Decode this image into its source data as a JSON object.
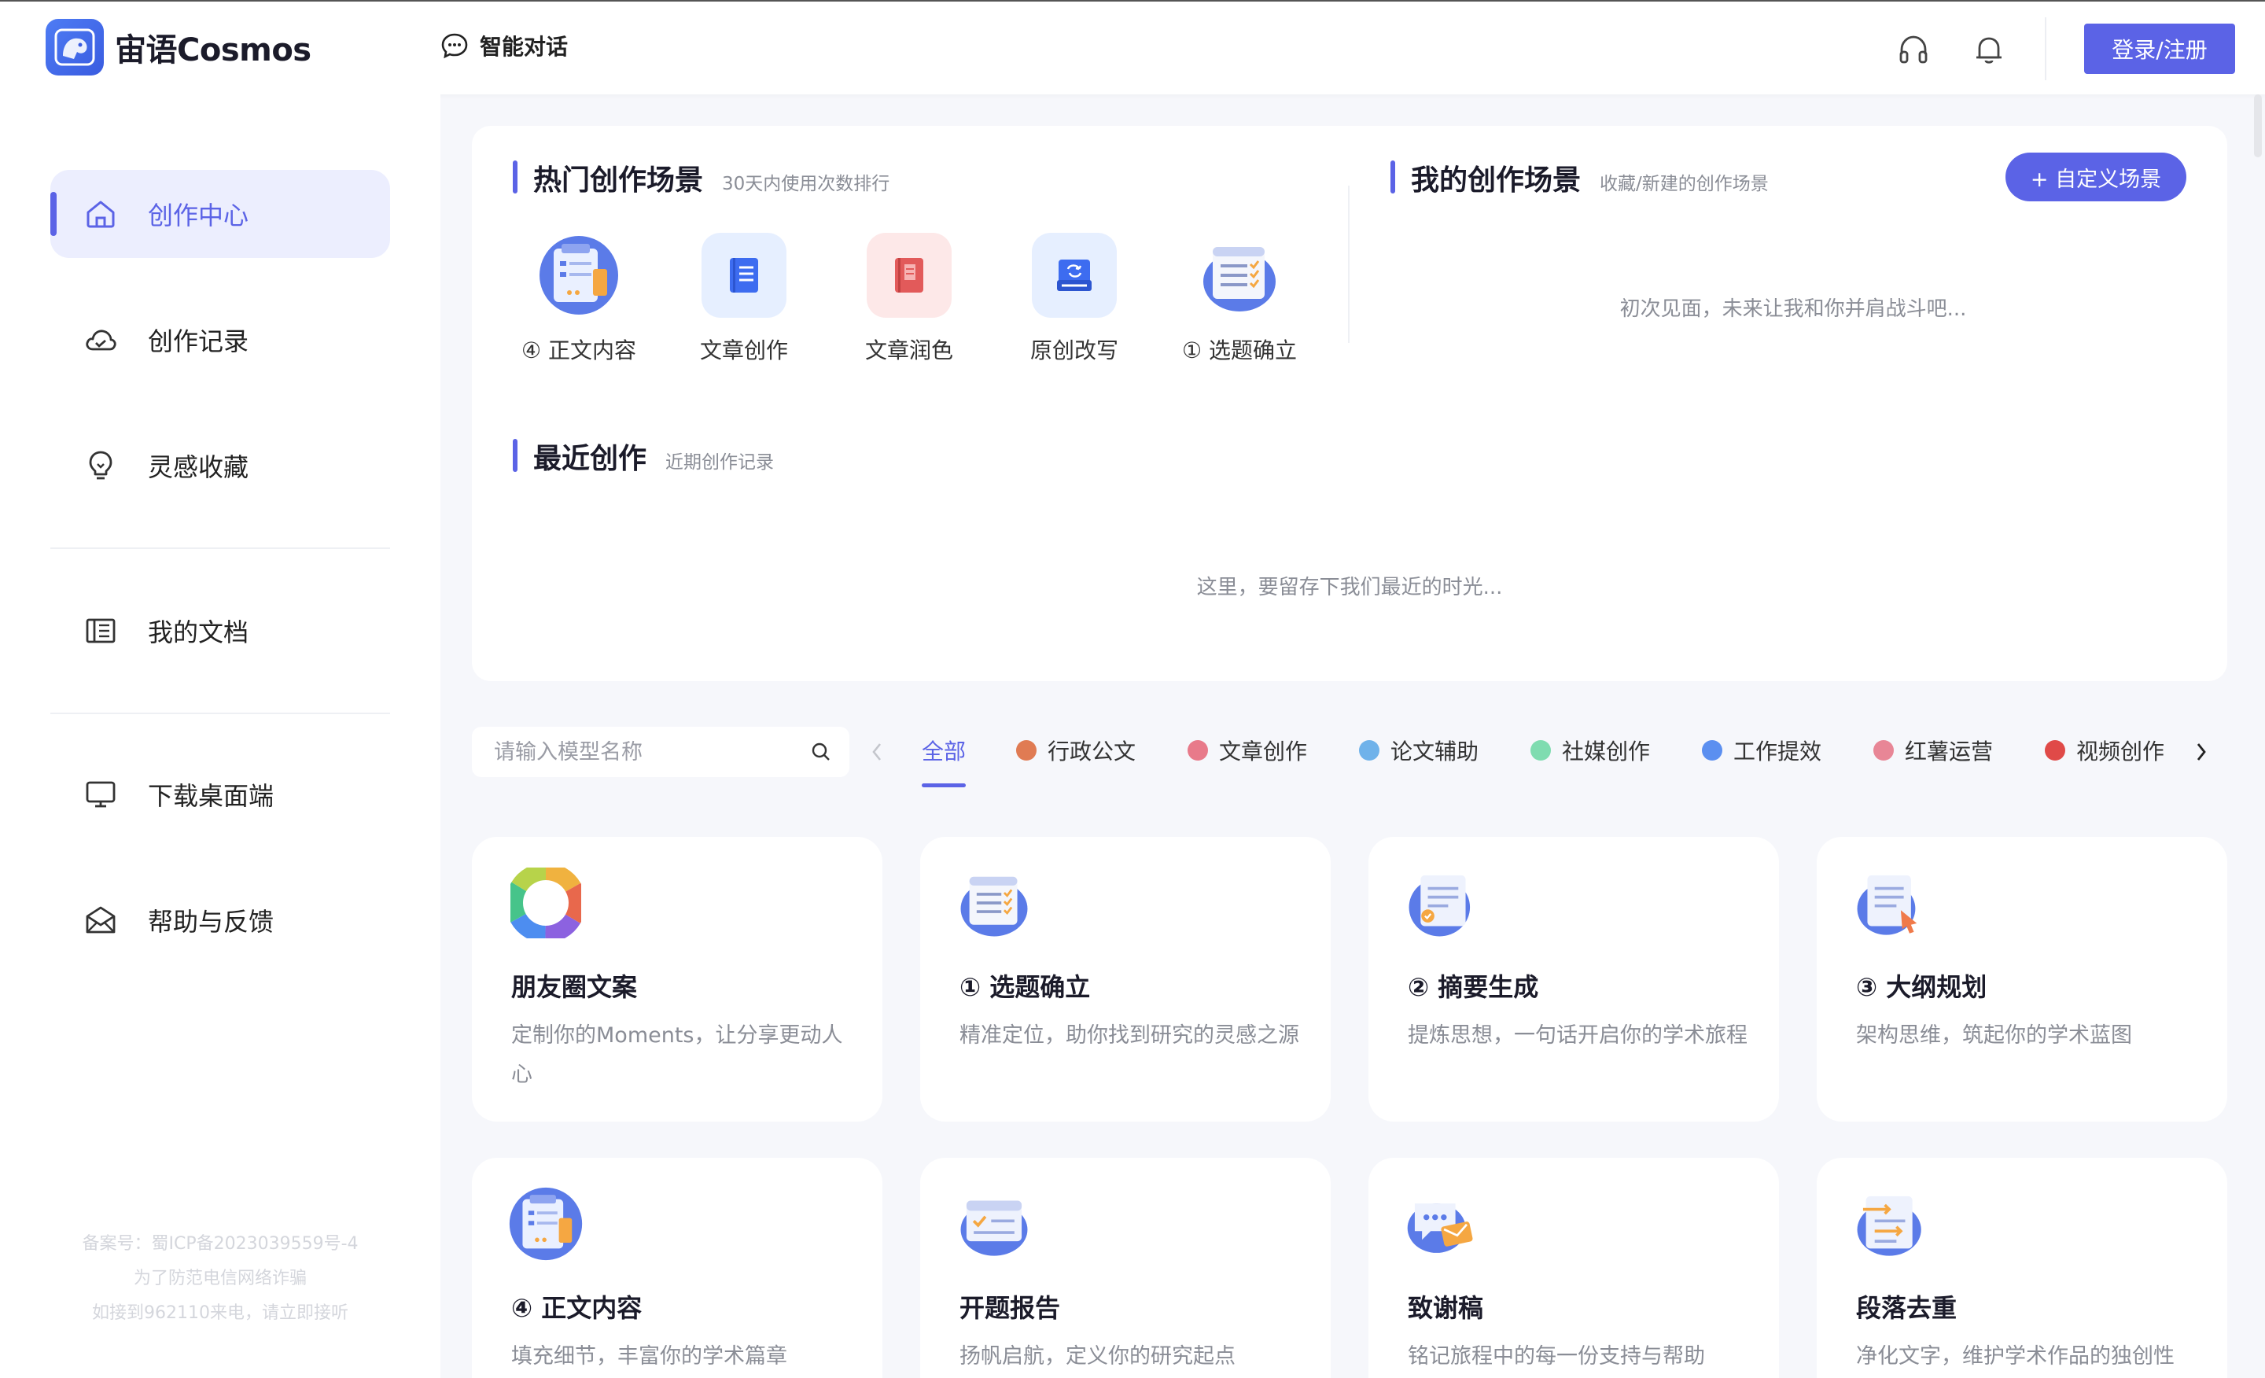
{
  "app": {
    "name": "宙语Cosmos"
  },
  "header": {
    "chat_label": "智能对话",
    "login_label": "登录/注册"
  },
  "sidebar": {
    "items": [
      {
        "label": "创作中心",
        "icon": "home-icon"
      },
      {
        "label": "创作记录",
        "icon": "cloud-icon"
      },
      {
        "label": "灵感收藏",
        "icon": "lightbulb-icon"
      },
      {
        "label": "我的文档",
        "icon": "document-book-icon"
      },
      {
        "label": "下载桌面端",
        "icon": "monitor-icon"
      },
      {
        "label": "帮助与反馈",
        "icon": "mail-icon"
      }
    ],
    "beian": [
      "备案号：蜀ICP备2023039559号-4",
      "为了防范电信网络诈骗",
      "如接到962110来电，请立即接听"
    ]
  },
  "hot": {
    "title": "热门创作场景",
    "subtitle": "30天内使用次数排行",
    "items": [
      {
        "label": "④ 正文内容"
      },
      {
        "label": "文章创作"
      },
      {
        "label": "文章润色"
      },
      {
        "label": "原创改写"
      },
      {
        "label": "① 选题确立"
      }
    ]
  },
  "mine": {
    "title": "我的创作场景",
    "subtitle": "收藏/新建的创作场景",
    "button": "+ 自定义场景",
    "empty": "初次见面，未来让我和你并肩战斗吧..."
  },
  "recent": {
    "title": "最近创作",
    "subtitle": "近期创作记录",
    "empty": "这里，要留存下我们最近的时光..."
  },
  "search": {
    "placeholder": "请输入模型名称"
  },
  "categories": [
    {
      "label": "全部",
      "color": ""
    },
    {
      "label": "行政公文",
      "color": "#e07b53"
    },
    {
      "label": "文章创作",
      "color": "#e87a8a"
    },
    {
      "label": "论文辅助",
      "color": "#6fb2ea"
    },
    {
      "label": "社媒创作",
      "color": "#7fdcb0"
    },
    {
      "label": "工作提效",
      "color": "#5b8ff0"
    },
    {
      "label": "红薯运营",
      "color": "#e88696"
    },
    {
      "label": "视频创作",
      "color": "#e04a48"
    }
  ],
  "cards": [
    {
      "title": "朋友圈文案",
      "desc": "定制你的Moments，让分享更动人心"
    },
    {
      "title": "① 选题确立",
      "desc": "精准定位，助你找到研究的灵感之源"
    },
    {
      "title": "② 摘要生成",
      "desc": "提炼思想，一句话开启你的学术旅程"
    },
    {
      "title": "③ 大纲规划",
      "desc": "架构思维，筑起你的学术蓝图"
    },
    {
      "title": "④ 正文内容",
      "desc": "填充细节，丰富你的学术篇章"
    },
    {
      "title": "开题报告",
      "desc": "扬帆启航，定义你的研究起点"
    },
    {
      "title": "致谢稿",
      "desc": "铭记旅程中的每一份支持与帮助"
    },
    {
      "title": "段落去重",
      "desc": "净化文字，维护学术作品的独创性"
    }
  ],
  "colors": {
    "accent": "#5b63e6",
    "active_bg": "#eceefe",
    "page_bg": "#f6f7fb"
  }
}
